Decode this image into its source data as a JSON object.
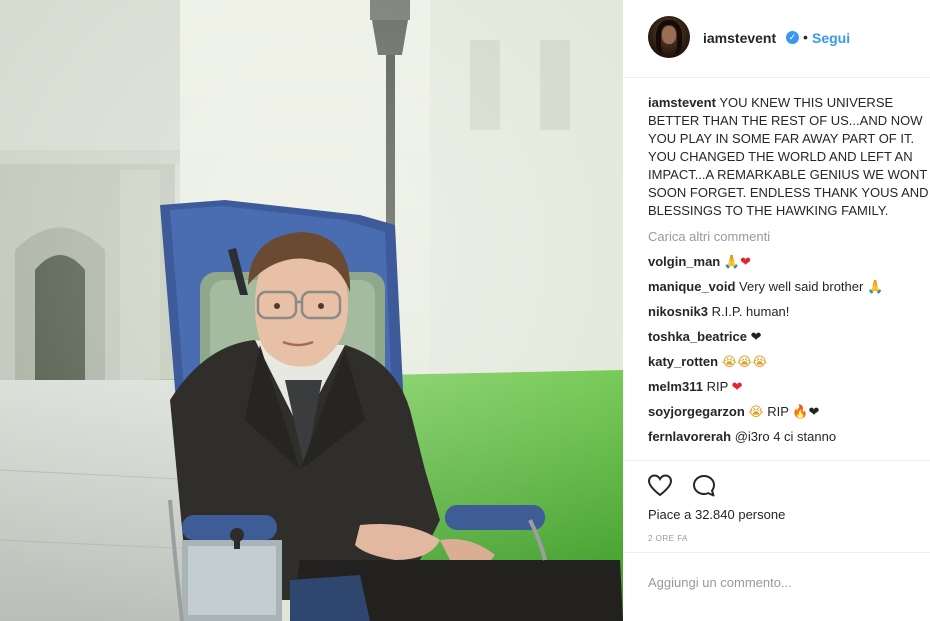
{
  "post": {
    "username": "iamstevent",
    "follow_label": "Segui",
    "caption_username": "iamstevent",
    "caption_text": "YOU KNEW THIS UNIVERSE BETTER THAN THE REST OF US...AND NOW YOU PLAY IN SOME FAR AWAY PART OF IT. YOU CHANGED THE WORLD AND LEFT AN IMPACT...A REMARKABLE GENIUS WE WONT SOON FORGET. ENDLESS THANK YOUS AND BLESSINGS TO THE HAWKING FAMILY.",
    "load_more_label": "Carica altri commenti",
    "likes_text": "Piace a 32.840 persone",
    "time_text": "2 ORE FA",
    "add_comment_placeholder": "Aggiungi un commento..."
  },
  "comments": [
    {
      "user": "volgin_man",
      "text": "",
      "emoji": [
        [
          "pray-emoji",
          "🙏",
          "pray"
        ],
        [
          "heart-emoji",
          "❤",
          "heart"
        ]
      ]
    },
    {
      "user": "manique_void",
      "text": "Very well said brother",
      "emoji": [
        [
          "pray-emoji",
          "🙏",
          "pray"
        ]
      ]
    },
    {
      "user": "nikosnik3",
      "text": "R.I.P. human!",
      "emoji": []
    },
    {
      "user": "toshka_beatrice",
      "text": "",
      "emoji": [
        [
          "black-heart-emoji",
          "❤",
          "black"
        ]
      ]
    },
    {
      "user": "katy_rotten",
      "text": "",
      "emoji": [
        [
          "crying-emoji",
          "😭",
          "cry"
        ],
        [
          "crying-emoji",
          "😭",
          "cry"
        ],
        [
          "crying-emoji",
          "😭",
          "cry"
        ]
      ]
    },
    {
      "user": "melm311",
      "text": "RIP",
      "emoji": [
        [
          "heart-emoji",
          "❤",
          "heart"
        ]
      ]
    },
    {
      "user": "soyjorgegarzon",
      "text": "RIP",
      "emoji": [
        [
          "crying-emoji",
          "😭",
          "cry"
        ],
        [
          "fire-emoji",
          "🔥",
          "fire"
        ],
        [
          "black-heart-emoji",
          "❤",
          "black"
        ]
      ],
      "emoji_split": 1
    },
    {
      "user": "fernlavorerah",
      "text": "@i3ro 4 ci stanno",
      "emoji": []
    }
  ],
  "icons": {
    "verified": "verified-badge-icon",
    "like": "heart-outline-icon",
    "comment": "comment-bubble-icon"
  },
  "colors": {
    "link": "#3897f0",
    "text": "#262626",
    "muted": "#999999",
    "verified": "#3897f0"
  }
}
